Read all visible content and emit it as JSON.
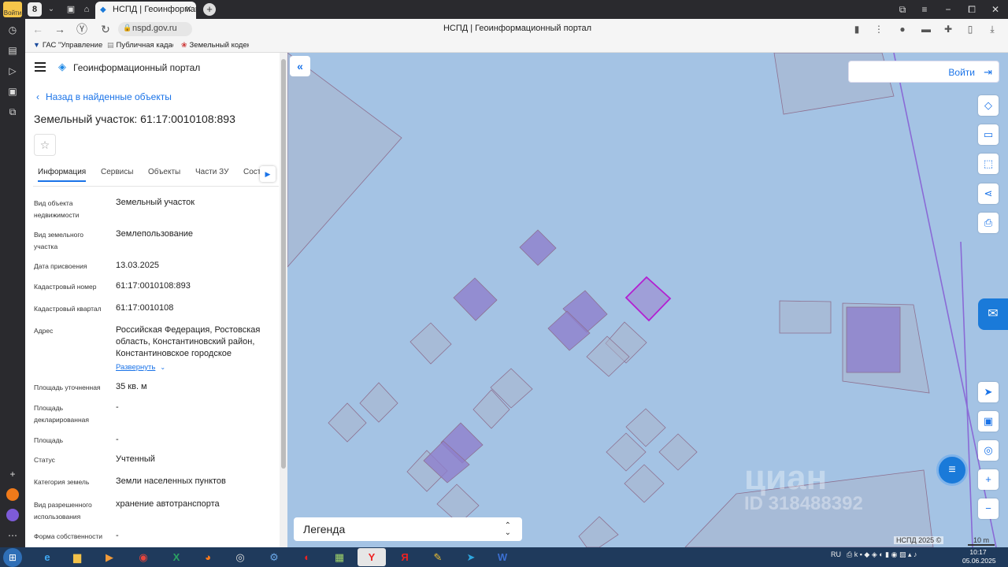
{
  "browser": {
    "profile_label": "Войти",
    "tab_count": "8",
    "active_tab_title": "НСПД | Геоинформацио",
    "url": "nspd.gov.ru",
    "page_title": "НСПД | Геоинформационный портал",
    "bookmarks": [
      "ГАС \"Управление",
      "Публичная кадас",
      "Земельный кодек"
    ]
  },
  "panel": {
    "portal_name": "Геоинформационный портал",
    "back_link": "Назад в найденные объекты",
    "object_title": "Земельный участок: 61:17:0010108:893",
    "tabs": [
      "Информация",
      "Сервисы",
      "Объекты",
      "Части ЗУ",
      "Сост"
    ],
    "active_tab": "Информация",
    "rows": [
      {
        "label": "Вид объекта недвижимости",
        "value": "Земельный участок"
      },
      {
        "label": "Вид земельного участка",
        "value": "Землепользование"
      },
      {
        "label": "Дата присвоения",
        "value": "13.03.2025"
      },
      {
        "label": "Кадастровый номер",
        "value": "61:17:0010108:893"
      },
      {
        "label": "Кадастровый квартал",
        "value": "61:17:0010108"
      },
      {
        "label": "Адрес",
        "value": "Российская Федерация, Ростовская область, Константиновский район, Константиновское городское"
      },
      {
        "label": "Площадь уточненная",
        "value": "35 кв. м"
      },
      {
        "label": "Площадь декларированная",
        "value": "-"
      },
      {
        "label": "Площадь",
        "value": "-"
      },
      {
        "label": "Статус",
        "value": "Учтенный"
      },
      {
        "label": "Категория земель",
        "value": "Земли населенных пунктов"
      },
      {
        "label": "Вид разрешенного использования",
        "value": "хранение автотранспорта"
      },
      {
        "label": "Форма собственности",
        "value": "-"
      }
    ],
    "expand_link": "Развернуть"
  },
  "map": {
    "login_label": "Войти",
    "legend_label": "Легенда",
    "watermark_brand": "циан",
    "watermark_id": "ID 318488392",
    "copyright": "НСПД 2025 ©",
    "scale": "10 m",
    "colors": {
      "water": "#a4c3e4",
      "parcel_fill": "#aab4cc",
      "selected_fill": "#8e7fcc",
      "highlight_stroke": "#b31fd1",
      "accent": "#1a73e8"
    }
  },
  "taskbar": {
    "lang": "RU",
    "time": "10:17",
    "date": "05.06.2025"
  }
}
